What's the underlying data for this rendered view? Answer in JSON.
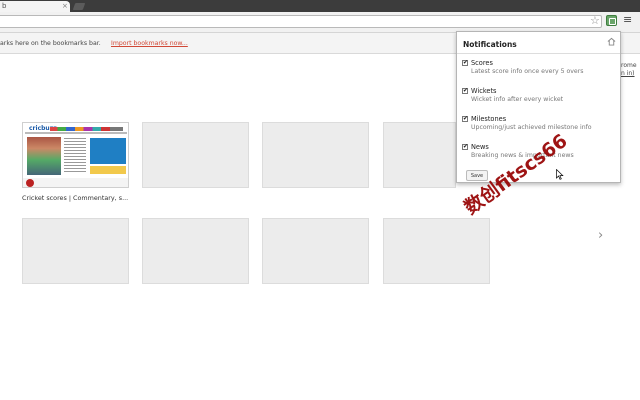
{
  "browser": {
    "tab_fragment": "b",
    "tab_close": "×",
    "menu_glyph": "≡",
    "star_glyph": "☆"
  },
  "bookmarks_bar": {
    "text": "arks here on the bookmarks bar.",
    "import_link": "Import bookmarks now..."
  },
  "signin": {
    "line1": "rome",
    "line2": "n in)"
  },
  "ntp": {
    "tile1_label": "Cricket scores | Commentary, s...",
    "thumb_logo": "cricbuzz",
    "next_glyph": "›"
  },
  "popup": {
    "title": "Notifications",
    "options": [
      {
        "title": "Scores",
        "desc": "Latest score info once every 5 overs",
        "checked": true
      },
      {
        "title": "Wickets",
        "desc": "Wicket info after every wicket",
        "checked": true
      },
      {
        "title": "Milestones",
        "desc": "Upcoming/just achieved milestone info",
        "checked": true
      },
      {
        "title": "News",
        "desc": "Breaking news & important news",
        "checked": true
      }
    ],
    "check_glyph": "✔",
    "save_label": "Save"
  },
  "watermark": "数创fitscs66"
}
